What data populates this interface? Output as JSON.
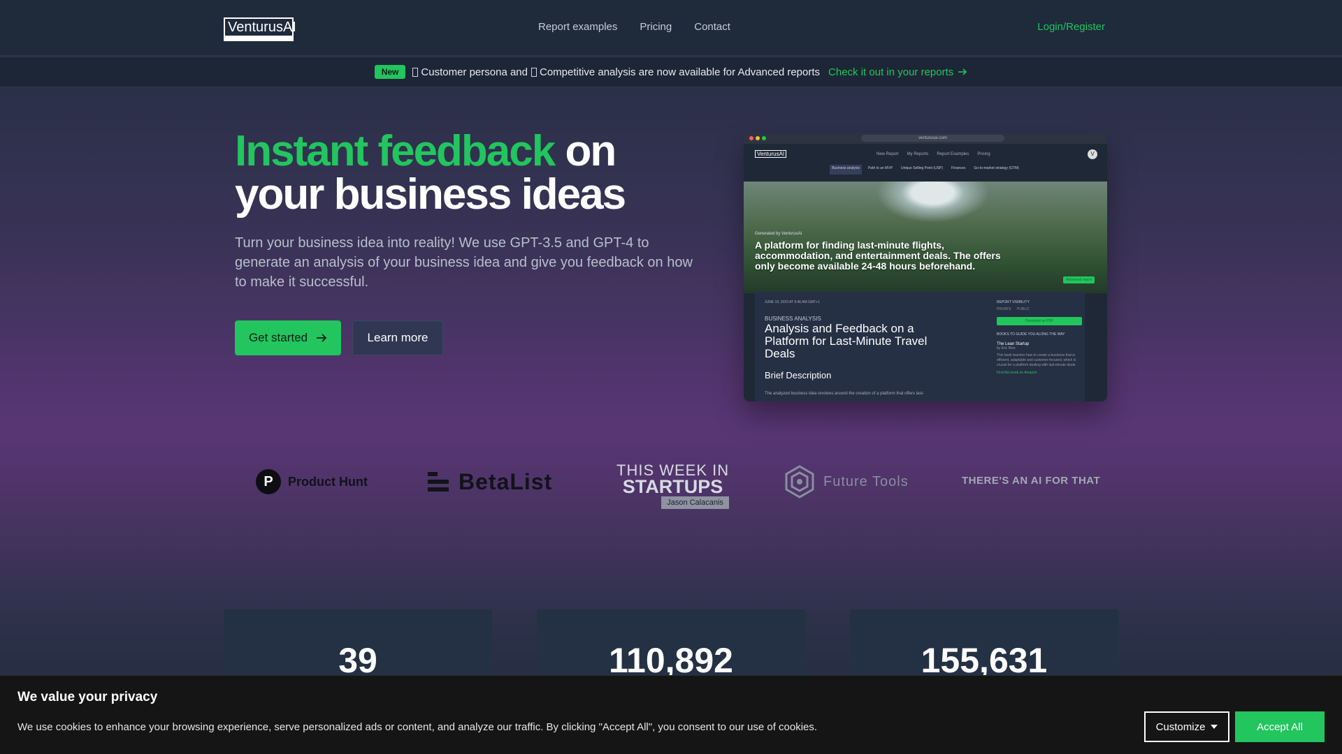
{
  "header": {
    "logo": "VenturusAI",
    "nav": [
      "Report examples",
      "Pricing",
      "Contact"
    ],
    "login": "Login/Register"
  },
  "announcement": {
    "badge": "New",
    "part1": "Customer persona and",
    "part2": "Competitive analysis are now available for Advanced reports",
    "link": "Check it out in your reports"
  },
  "hero": {
    "title_green": "Instant feedback",
    "title_rest_1": "on",
    "title_rest_2": "your business ideas",
    "subtitle": "Turn your business idea into reality! We use GPT-3.5 and GPT-4 to generate an analysis of your business idea and give you feedback on how to make it successful.",
    "primary_button": "Get started",
    "secondary_button": "Learn more"
  },
  "mockup": {
    "url": "venturusai.com",
    "logo": "VenturusAI",
    "nav": [
      "New Report",
      "My Reports",
      "Report Examples",
      "Pricing"
    ],
    "avatar": "V",
    "tabs": [
      "Business analysis",
      "Path to an MVP",
      "Unique Selling Point (USP)",
      "Finances",
      "Go-to-market strategy (GTM)"
    ],
    "generated_by": "Generated by VenturusAI",
    "hero_title": "A platform for finding last-minute flights, accommodation, and entertainment deals. The offers only become available 24-48 hours beforehand.",
    "advanced_badge": "Advanced report",
    "date": "JUNE 19, 2023 AT 9:46 AM GMT+1",
    "category": "BUSINESS ANALYSIS",
    "report_title": "Analysis and Feedback on a Platform for Last-Minute Travel Deals",
    "section": "Brief Description",
    "body": "The analyzed business idea revolves around the creation of a platform that offers last-",
    "side_visibility": "REPORT VISIBILITY",
    "side_private": "PRIVATE",
    "side_public": "PUBLIC",
    "side_download": "Download as PDF",
    "side_books": "BOOKS TO GUIDE YOU ALONG THE WAY",
    "book_title": "The Lean Startup",
    "book_author": "by Eric Ries",
    "book_text": "This book teaches how to create a business that is efficient, adaptable and customer-focused, which is crucial for a platform dealing with last-minute deals.",
    "book_link": "Find this book on Amazon"
  },
  "featured": {
    "product_hunt": "Product Hunt",
    "product_hunt_letter": "P",
    "betalist": "BetaList",
    "twis_line1": "THIS WEEK IN",
    "twis_line2": "STARTUPS",
    "twis_host": "Jason Calacanis",
    "future_tools": "Future Tools",
    "aift": "THERE'S AN AI FOR THAT"
  },
  "stats": [
    "39",
    "110,892",
    "155,631"
  ],
  "cookie": {
    "title": "We value your privacy",
    "text": "We use cookies to enhance your browsing experience, serve personalized ads or content, and analyze our traffic. By clicking \"Accept All\", you consent to our use of cookies.",
    "customize": "Customize",
    "accept": "Accept All"
  },
  "colors": {
    "accent": "#22c55e",
    "header_bg": "#1f2a3b",
    "cookie_bg": "#151515"
  }
}
